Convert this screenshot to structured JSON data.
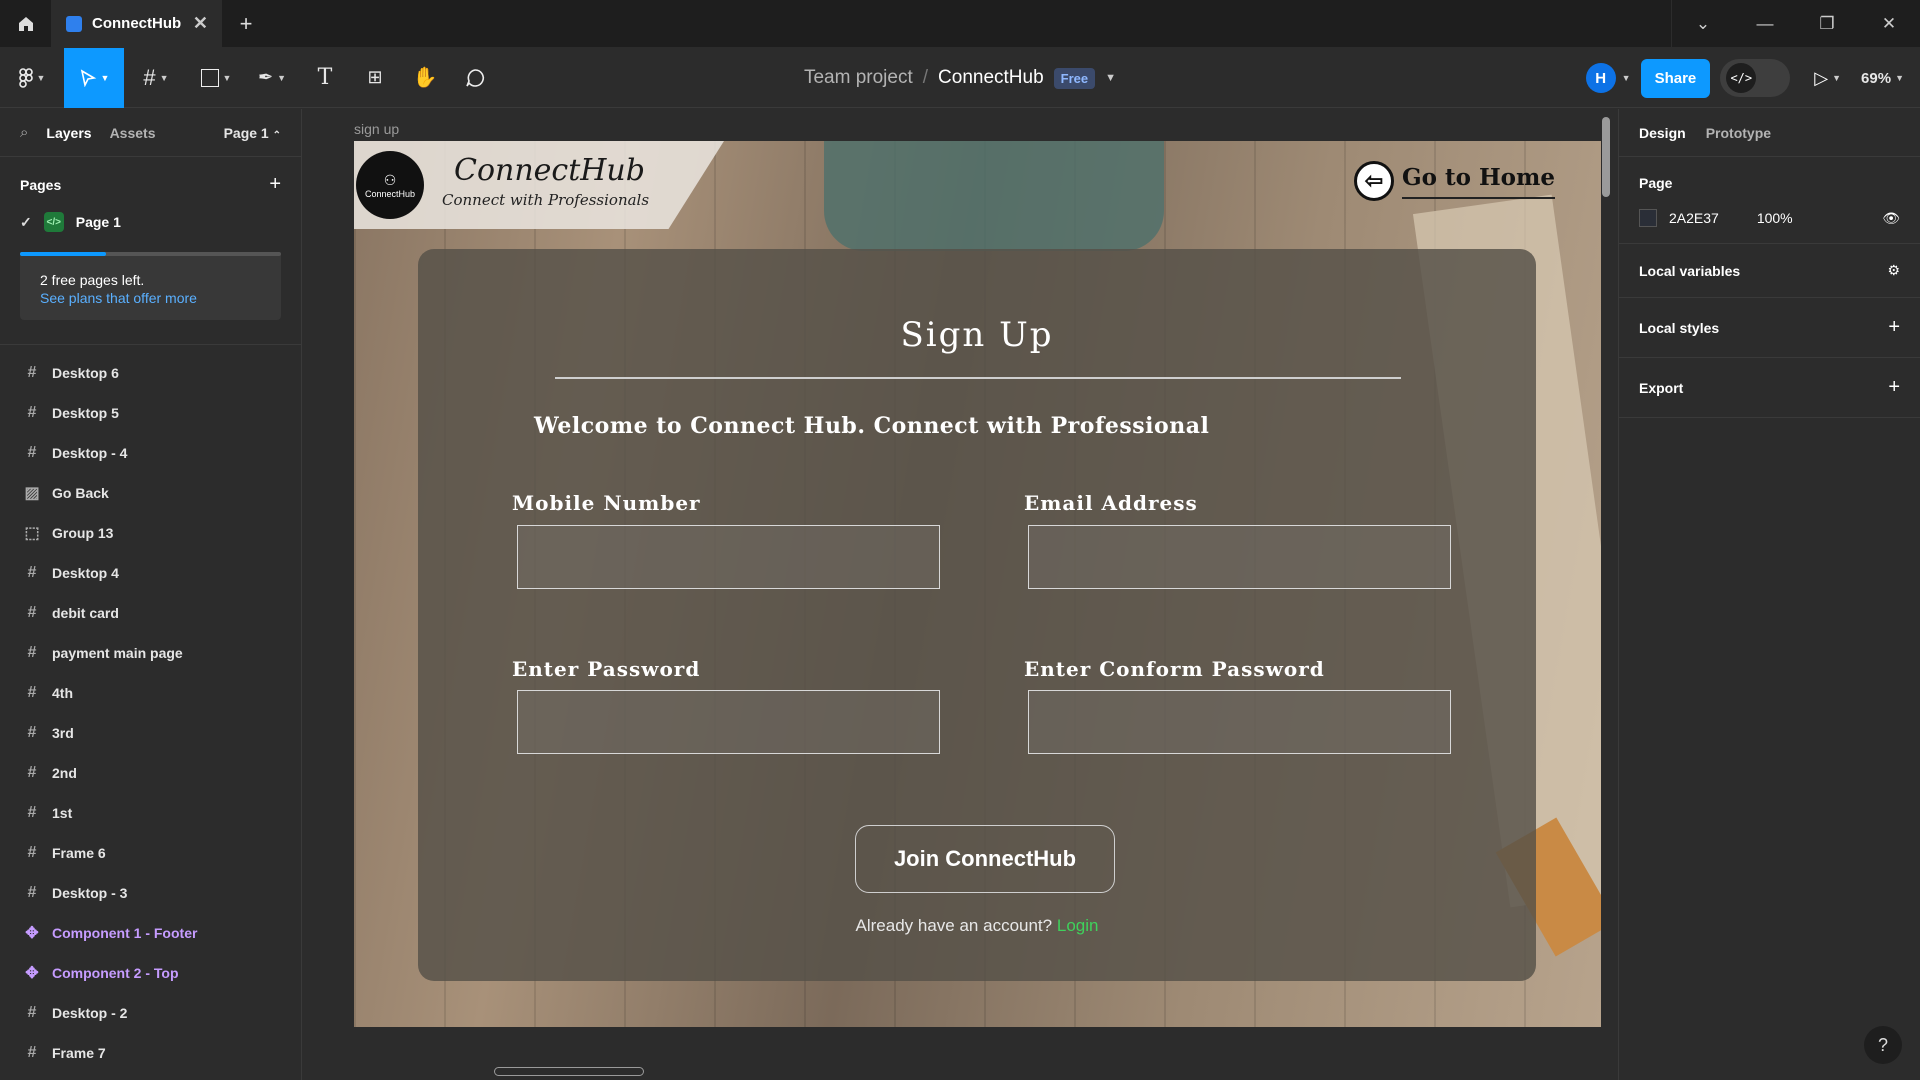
{
  "tab": {
    "title": "ConnectHub"
  },
  "header": {
    "project": "Team project",
    "separator": "/",
    "file": "ConnectHub",
    "plan_badge": "Free",
    "avatar_letter": "H",
    "share_label": "Share",
    "zoom": "69%"
  },
  "left_panel": {
    "tabs": [
      "Layers",
      "Assets"
    ],
    "page_selector": "Page 1",
    "pages_heading": "Pages",
    "current_page": "Page 1",
    "free_pages": {
      "text": "2 free pages left.",
      "link": "See plans that offer more",
      "used_fraction": 0.33
    },
    "layers": [
      {
        "label": "Desktop 6",
        "kind": "frame"
      },
      {
        "label": "Desktop 5",
        "kind": "frame"
      },
      {
        "label": "Desktop - 4",
        "kind": "frame"
      },
      {
        "label": "Go Back",
        "kind": "image"
      },
      {
        "label": "Group 13",
        "kind": "group"
      },
      {
        "label": "Desktop 4",
        "kind": "frame"
      },
      {
        "label": "debit card",
        "kind": "frame"
      },
      {
        "label": "payment main page",
        "kind": "frame"
      },
      {
        "label": "4th",
        "kind": "frame"
      },
      {
        "label": "3rd",
        "kind": "frame"
      },
      {
        "label": "2nd",
        "kind": "frame"
      },
      {
        "label": "1st",
        "kind": "frame"
      },
      {
        "label": "Frame 6",
        "kind": "frame"
      },
      {
        "label": "Desktop - 3",
        "kind": "frame"
      },
      {
        "label": "Component 1 - Footer",
        "kind": "component"
      },
      {
        "label": "Component 2 - Top",
        "kind": "component"
      },
      {
        "label": "Desktop - 2",
        "kind": "frame"
      },
      {
        "label": "Frame 7",
        "kind": "frame"
      }
    ]
  },
  "canvas": {
    "frame_label": "sign up",
    "logo_title": "ConnectHub",
    "logo_tagline": "Connect with Professionals",
    "logo_mark_text": "ConnectHub",
    "go_home": "Go to Home",
    "form": {
      "title": "Sign Up",
      "welcome": "Welcome to Connect Hub. Connect with Professional",
      "mobile_label": "Mobile Number",
      "email_label": "Email Address",
      "password_label": "Enter Password",
      "confirm_label": "Enter Conform Password",
      "submit": "Join ConnectHub",
      "login_prompt": "Already have an account?",
      "login_link": "Login"
    }
  },
  "right_panel": {
    "tabs": [
      "Design",
      "Prototype"
    ],
    "page_heading": "Page",
    "bg_color": "2A2E37",
    "bg_opacity": "100%",
    "sections": [
      "Local variables",
      "Local styles",
      "Export"
    ]
  },
  "colors": {
    "accent": "#0d99ff",
    "login_link": "#3fd15c",
    "component": "#c69cff",
    "page_bg": "#2A2E37"
  }
}
